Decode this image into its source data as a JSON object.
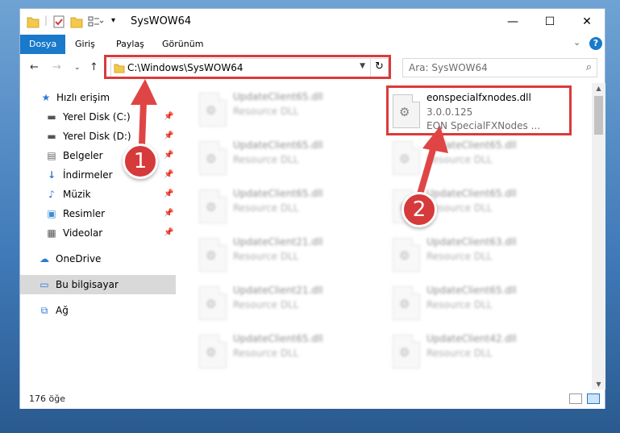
{
  "window": {
    "title": "SysWOW64",
    "controls": {
      "minimize": "—",
      "maximize": "☐",
      "close": "✕"
    }
  },
  "ribbon": {
    "tabs": [
      {
        "label": "Dosya",
        "active": true
      },
      {
        "label": "Giriş",
        "active": false
      },
      {
        "label": "Paylaş",
        "active": false
      },
      {
        "label": "Görünüm",
        "active": false
      }
    ]
  },
  "nav": {
    "address": "C:\\Windows\\SysWOW64",
    "search_placeholder": "Ara: SysWOW64"
  },
  "sidebar": {
    "items": [
      {
        "label": "Hızlı erişim",
        "icon": "star-icon",
        "pinned": false
      },
      {
        "label": "Yerel Disk (C:)",
        "icon": "drive-icon",
        "pinned": true
      },
      {
        "label": "Yerel Disk (D:)",
        "icon": "drive-icon",
        "pinned": true
      },
      {
        "label": "Belgeler",
        "icon": "documents-icon",
        "pinned": true
      },
      {
        "label": "İndirmeler",
        "icon": "download-icon",
        "pinned": true
      },
      {
        "label": "Müzik",
        "icon": "music-icon",
        "pinned": true
      },
      {
        "label": "Resimler",
        "icon": "pictures-icon",
        "pinned": true
      },
      {
        "label": "Videolar",
        "icon": "videos-icon",
        "pinned": true
      },
      {
        "label": "OneDrive",
        "icon": "cloud-icon",
        "pinned": false
      },
      {
        "label": "Bu bilgisayar",
        "icon": "computer-icon",
        "pinned": false,
        "selected": true
      },
      {
        "label": "Ağ",
        "icon": "network-icon",
        "pinned": false
      }
    ]
  },
  "files": {
    "highlighted": {
      "name": "eonspecialfxnodes.dll",
      "version": "3.0.0.125",
      "description": "EON SpecialFXNodes ..."
    },
    "left_column": [
      {
        "name": "UpdateClient65.dll",
        "desc": "Resource DLL"
      },
      {
        "name": "UpdateClient65.dll",
        "desc": "Resource DLL"
      },
      {
        "name": "UpdateClient65.dll",
        "desc": "Resource DLL"
      },
      {
        "name": "UpdateClient21.dll",
        "desc": "Resource DLL"
      },
      {
        "name": "UpdateClient21.dll",
        "desc": "Resource DLL"
      },
      {
        "name": "UpdateClient65.dll",
        "desc": "Resource DLL"
      }
    ],
    "right_column": [
      {
        "name": "UpdateClient65.dll",
        "desc": "Resource DLL"
      },
      {
        "name": "UpdateClient65.dll",
        "desc": "Resource DLL"
      },
      {
        "name": "UpdateClient63.dll",
        "desc": "Resource DLL"
      },
      {
        "name": "UpdateClient65.dll",
        "desc": "Resource DLL"
      },
      {
        "name": "UpdateClient42.dll",
        "desc": "Resource DLL"
      }
    ]
  },
  "status": {
    "count": "176 öğe"
  },
  "annotations": {
    "step1": "1",
    "step2": "2",
    "color": "#d63a3a"
  }
}
